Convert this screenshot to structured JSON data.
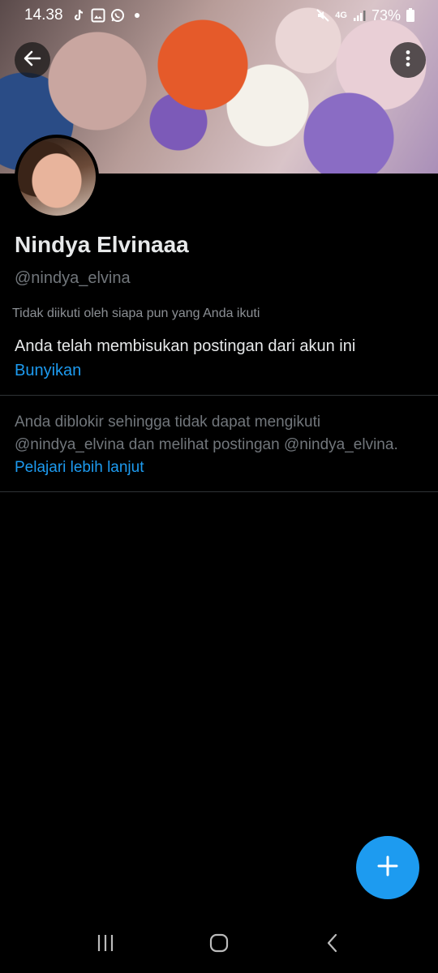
{
  "status_bar": {
    "time": "14.38",
    "network": "4G",
    "battery": "73%"
  },
  "profile": {
    "name": "Nindya Elvinaaa",
    "handle": "@nindya_elvina",
    "followed_by": "Tidak diikuti oleh siapa pun yang Anda ikuti",
    "muted_message": "Anda telah membisukan postingan dari akun ini",
    "unmute_label": "Bunyikan"
  },
  "blocked": {
    "message": "Anda diblokir sehingga tidak dapat mengikuti @nindya_elvina dan melihat postingan @nindya_elvina.",
    "learn_more": "Pelajari lebih lanjut"
  },
  "icons": {
    "back": "arrow-left-icon",
    "more": "more-vertical-icon",
    "compose": "plus-icon",
    "recents": "recents-icon",
    "home": "home-icon",
    "nav_back": "chevron-left-icon"
  },
  "colors": {
    "accent": "#1d9bf0",
    "background": "#000000",
    "secondary_text": "#71767b"
  }
}
